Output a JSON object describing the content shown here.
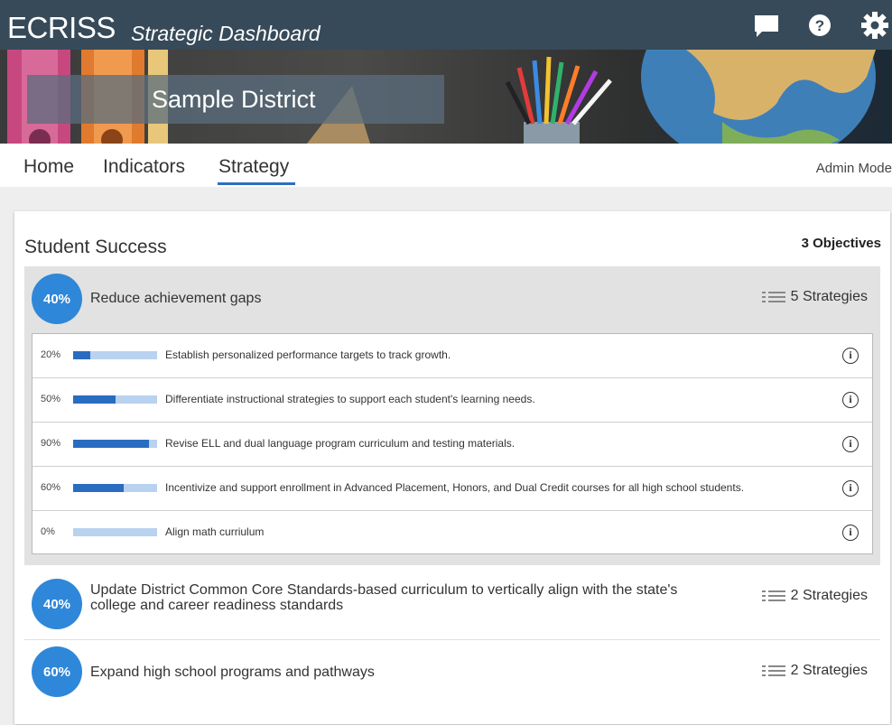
{
  "header": {
    "app_name": "ECRISS",
    "app_subtitle": "Strategic Dashboard",
    "icons": [
      "chat-icon",
      "help-icon",
      "settings-gear-icon"
    ]
  },
  "banner": {
    "district_name": "Sample District"
  },
  "nav": {
    "tabs": [
      {
        "label": "Home",
        "active": false
      },
      {
        "label": "Indicators",
        "active": false
      },
      {
        "label": "Strategy",
        "active": true
      }
    ],
    "admin_mode": "Admin Mode"
  },
  "goal": {
    "title": "Student Success",
    "objectives_count": "3 Objectives",
    "objectives": [
      {
        "percent": "40%",
        "title": "Reduce achievement gaps",
        "strategies_label": "5 Strategies",
        "expanded": true,
        "strategies": [
          {
            "percent": "20%",
            "progress": 0.2,
            "text": "Establish personalized performance targets to track growth."
          },
          {
            "percent": "50%",
            "progress": 0.5,
            "text": "Differentiate instructional strategies to support each student's learning needs."
          },
          {
            "percent": "90%",
            "progress": 0.9,
            "text": "Revise ELL and dual language program curriculum and testing materials."
          },
          {
            "percent": "60%",
            "progress": 0.6,
            "text": "Incentivize and support enrollment in Advanced Placement, Honors, and Dual Credit courses for all high school students."
          },
          {
            "percent": "0%",
            "progress": 0.0,
            "text": "Align math curriulum"
          }
        ]
      },
      {
        "percent": "40%",
        "title_line1": "Update District Common Core Standards-based curriculum to vertically align with the state's",
        "title_line2": "college and career readiness standards",
        "strategies_label": "2 Strategies",
        "expanded": false
      },
      {
        "percent": "60%",
        "title": "Expand high school programs and pathways",
        "strategies_label": "2 Strategies",
        "expanded": false
      }
    ]
  },
  "colors": {
    "topbar": "#374a59",
    "badge": "#2f87d9",
    "progress_fill": "#2a6cc0",
    "progress_track": "#b9d2ef",
    "nav_underline": "#2e6fbf"
  }
}
